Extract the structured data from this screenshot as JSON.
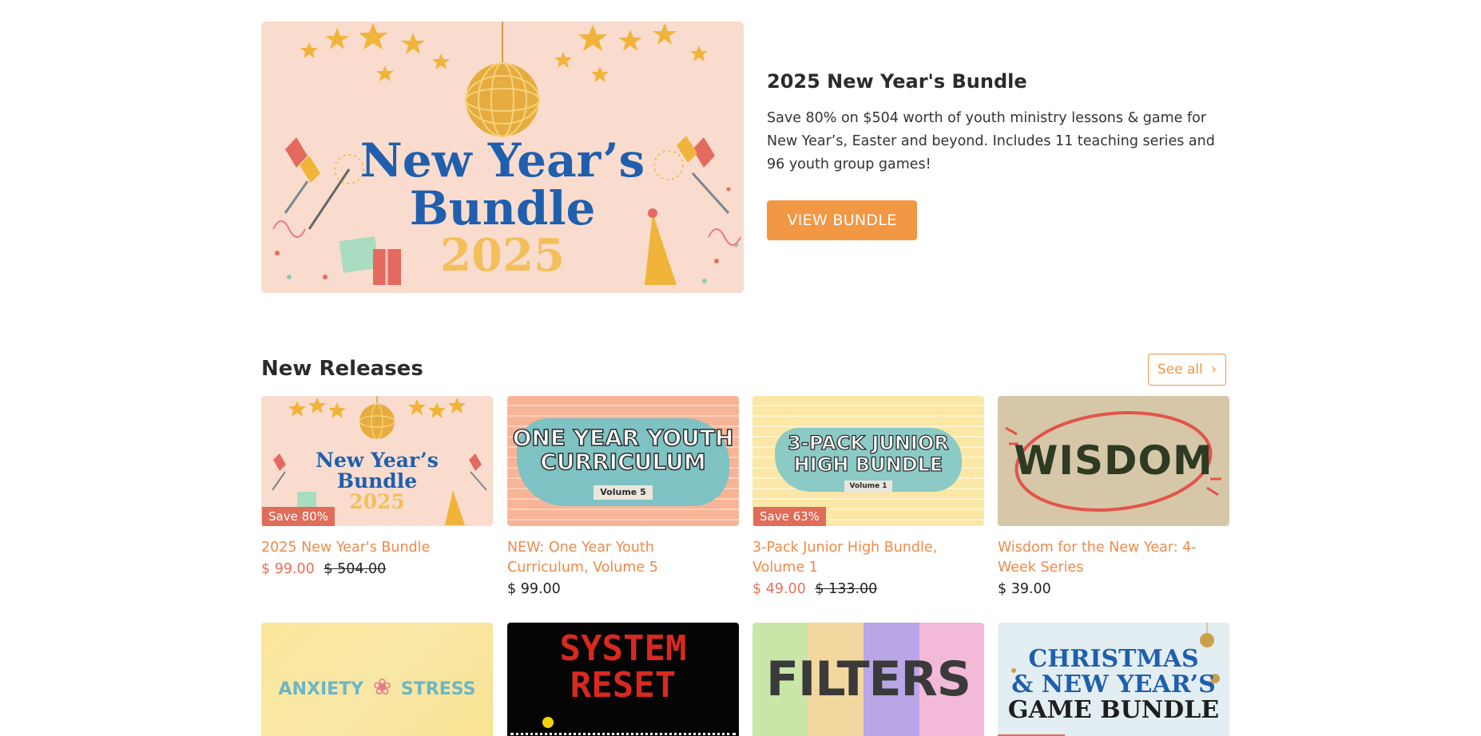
{
  "hero": {
    "image_alt": "New Year's Bundle 2025 banner",
    "art_line1": "New Year’s",
    "art_line2": "Bundle",
    "art_line3": "2025",
    "heading": "2025 New Year's Bundle",
    "description": "Save 80% on $504 worth of youth ministry lessons & game for New Year’s, Easter and beyond. Includes 11 teaching series and 96 youth group games!",
    "button_label": "VIEW BUNDLE"
  },
  "new_releases": {
    "title": "New Releases",
    "see_all_label": "See all",
    "products": [
      {
        "title": "2025 New Year's Bundle",
        "art_lines": [
          "New Year’s",
          "Bundle",
          "2025"
        ],
        "badge": "Save 80%",
        "price": "$ 99.00",
        "compare_price": "$ 504.00"
      },
      {
        "title": "NEW: One Year Youth Curriculum, Volume 5",
        "art_lines": [
          "ONE YEAR YOUTH",
          "CURRICULUM",
          "Volume 5"
        ],
        "price": "$ 99.00"
      },
      {
        "title": "3-Pack Junior High Bundle, Volume 1",
        "art_lines": [
          "3-PACK JUNIOR",
          "HIGH BUNDLE",
          "Volume 1"
        ],
        "badge": "Save 63%",
        "price": "$ 49.00",
        "compare_price": "$ 133.00"
      },
      {
        "title": "Wisdom for the New Year: 4-Week Series",
        "art_lines": [
          "WISDOM"
        ],
        "price": "$ 39.00"
      }
    ],
    "second_row_art": [
      {
        "lines": [
          "ANXIETY",
          "STRESS"
        ]
      },
      {
        "lines": [
          "SYSTEM",
          "RESET"
        ]
      },
      {
        "lines": [
          "FILTERS"
        ]
      },
      {
        "lines": [
          "CHRISTMAS",
          "& NEW YEAR’S",
          "GAME BUNDLE"
        ]
      }
    ]
  }
}
